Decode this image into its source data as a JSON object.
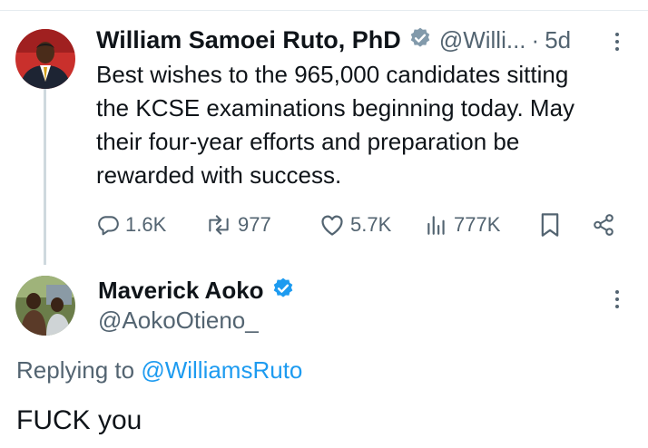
{
  "tweet1": {
    "author_name": "William Samoei Ruto, PhD",
    "handle": "@Willi...",
    "separator": "·",
    "age": "5d",
    "text": "Best wishes to the 965,000 candidates sitting the KCSE examinations beginning today. May their four-year efforts and preparation be rewarded with success.",
    "verified_badge": "gray",
    "actions": {
      "replies": "1.6K",
      "reposts": "977",
      "likes": "5.7K",
      "views": "777K"
    }
  },
  "tweet2": {
    "author_name": "Maverick Aoko",
    "handle": "@AokoOtieno_",
    "verified_badge": "blue",
    "replying_prefix": "Replying to",
    "replying_to": "@WilliamsRuto",
    "text": "FUCK you"
  },
  "colors": {
    "text": "#0f1419",
    "muted": "#536471",
    "link": "#1d9bf0",
    "verified_blue": "#1d9bf0",
    "verified_gray": "#829aab"
  },
  "icons": [
    "reply-icon",
    "repost-icon",
    "like-icon",
    "views-icon",
    "bookmark-icon",
    "share-icon",
    "more-icon",
    "verified-icon"
  ]
}
